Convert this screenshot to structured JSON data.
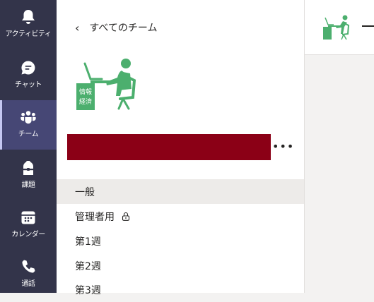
{
  "rail": {
    "items": [
      {
        "label": "アクティビティ",
        "icon": "bell-icon"
      },
      {
        "label": "チャット",
        "icon": "chat-icon"
      },
      {
        "label": "チーム",
        "icon": "teams-icon",
        "active": true
      },
      {
        "label": "課題",
        "icon": "assignments-icon"
      },
      {
        "label": "カレンダー",
        "icon": "calendar-icon"
      },
      {
        "label": "通話",
        "icon": "phone-icon"
      }
    ]
  },
  "panel": {
    "back_label": "すべてのチーム",
    "team_logo": {
      "lines": [
        "情報",
        "経済"
      ],
      "color": "#4caf6e"
    },
    "team_name_bar_color": "#8b0016",
    "more_label": "•••",
    "channels": [
      {
        "label": "一般",
        "selected": true
      },
      {
        "label": "管理者用",
        "locked": true
      },
      {
        "label": "第1週"
      },
      {
        "label": "第2週"
      },
      {
        "label": "第3週"
      }
    ]
  },
  "colors": {
    "rail_bg": "#33344a",
    "rail_active": "#464775",
    "accent": "#c5c7f2"
  }
}
